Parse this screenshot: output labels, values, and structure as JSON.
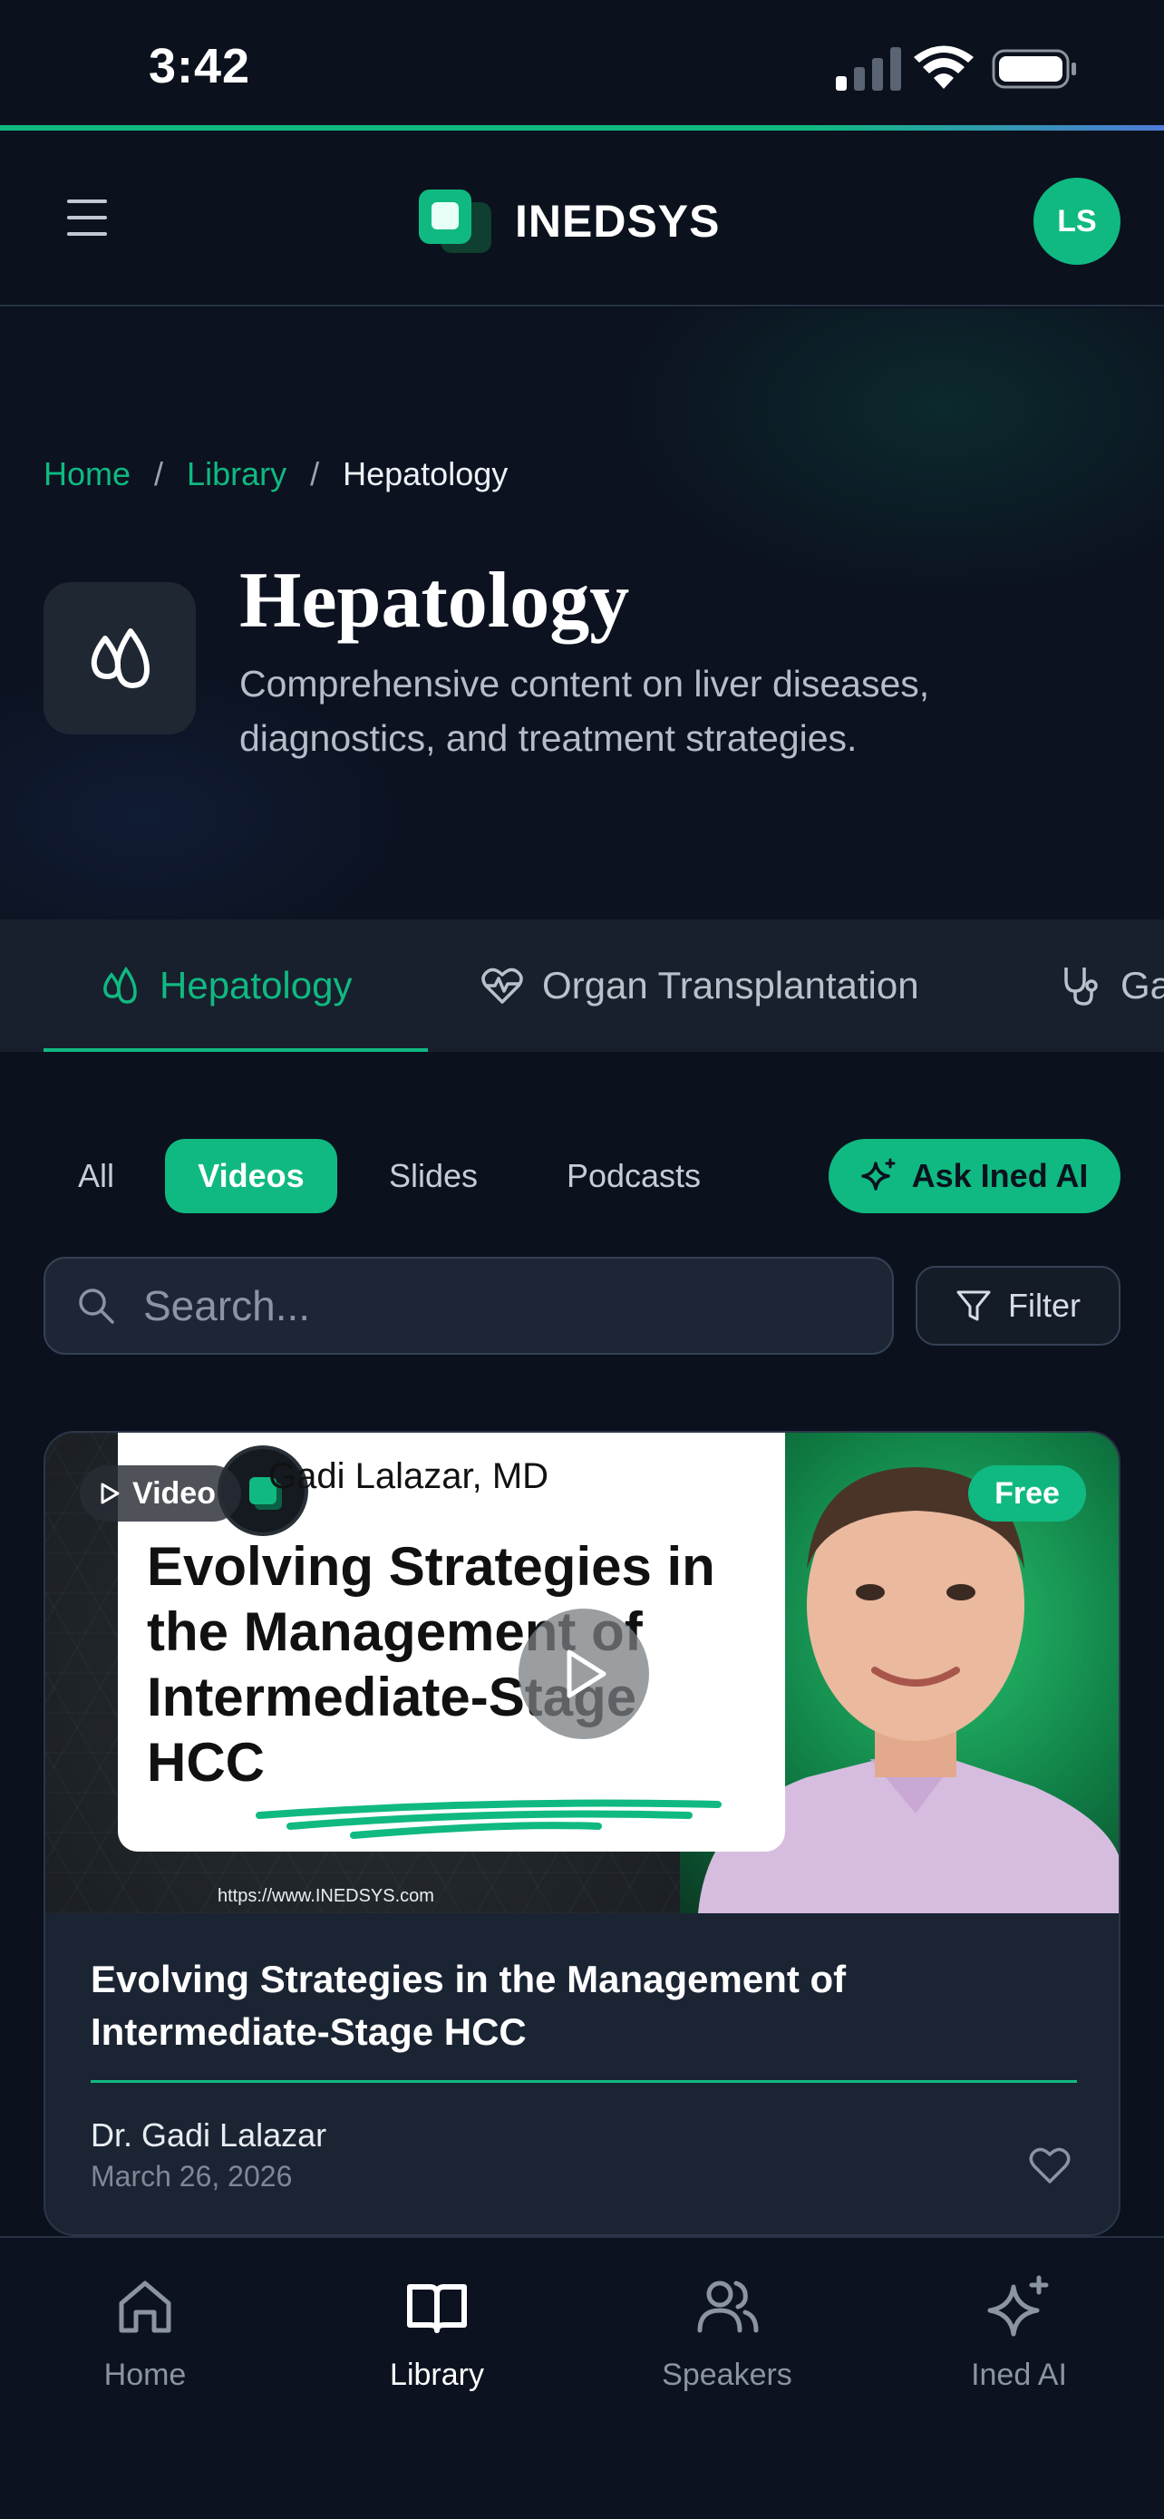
{
  "status_bar": {
    "time": "3:42"
  },
  "header": {
    "brand": "INEDSYS",
    "avatar_initials": "LS"
  },
  "breadcrumb": [
    {
      "label": "Home"
    },
    {
      "label": "Library"
    },
    {
      "label": "Hepatology"
    }
  ],
  "breadcrumb_separator": "/",
  "hero": {
    "title": "Hepatology",
    "description": "Comprehensive content on liver diseases, diagnostics, and treatment strategies."
  },
  "category_tabs": [
    {
      "label": "Hepatology",
      "icon": "drops-icon",
      "active": true
    },
    {
      "label": "Organ Transplantation",
      "icon": "heart-pulse-icon",
      "active": false
    },
    {
      "label": "Ga",
      "icon": "stethoscope-icon",
      "active": false
    }
  ],
  "content_filters": [
    {
      "label": "All",
      "active": false
    },
    {
      "label": "Videos",
      "active": true
    },
    {
      "label": "Slides",
      "active": false
    },
    {
      "label": "Podcasts",
      "active": false
    }
  ],
  "ask_ai": {
    "label": "Ask Ined AI"
  },
  "search": {
    "placeholder": "Search..."
  },
  "filter_button": {
    "label": "Filter"
  },
  "card": {
    "type_badge": "Video",
    "price_badge": "Free",
    "thumbnail": {
      "speaker": "Gadi Lalazar, MD",
      "title": "Evolving Strategies in the Management of Intermediate-Stage HCC",
      "url": "https://www.INEDSYS.com"
    },
    "title": "Evolving Strategies in the Management of Intermediate-Stage HCC",
    "author": "Dr. Gadi Lalazar",
    "date": "March 26, 2026"
  },
  "bottom_nav": [
    {
      "label": "Home",
      "icon": "home-icon",
      "active": false
    },
    {
      "label": "Library",
      "icon": "book-open-icon",
      "active": true
    },
    {
      "label": "Speakers",
      "icon": "users-icon",
      "active": false
    },
    {
      "label": "Ined AI",
      "icon": "sparkles-icon",
      "active": false
    }
  ],
  "colors": {
    "accent": "#10b981",
    "background": "#0b111d",
    "surface": "#1b2433"
  }
}
